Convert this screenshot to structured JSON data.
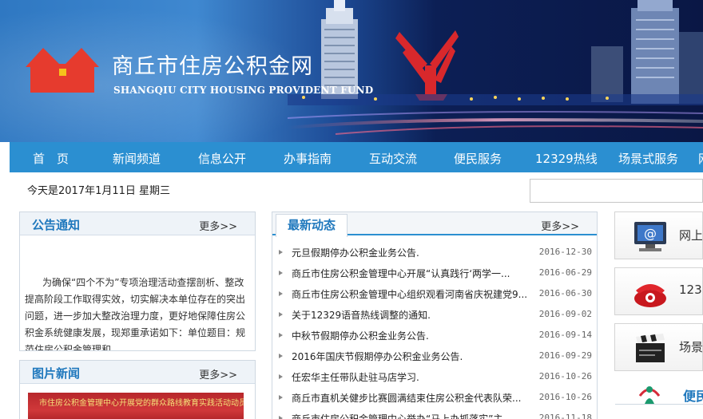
{
  "header": {
    "title": "商丘市住房公积金网",
    "subtitle": "SHANGQIU CITY HOUSING PROVIDENT FUND"
  },
  "nav": [
    {
      "label": "首　页"
    },
    {
      "label": "新闻频道"
    },
    {
      "label": "信息公开"
    },
    {
      "label": "办事指南"
    },
    {
      "label": "互动交流"
    },
    {
      "label": "便民服务"
    },
    {
      "label": "12329热线"
    },
    {
      "label": "场景式服务"
    },
    {
      "label": "网"
    }
  ],
  "date_line": "今天是2017年1月11日  星期三",
  "notice": {
    "title": "公告通知",
    "more": "更多>>",
    "body": "为确保“四个不为”专项治理活动查摆剖析、整改提高阶段工作取得实效，切实解决本单位存在的突出问题，进一步加大整改治理力度，更好地保障住房公积金系统健康发展，现郑重承诺如下：单位题目：规范住房公积金管理和"
  },
  "photo_news": {
    "title": "图片新闻",
    "more": "更多>>",
    "caption": "市住房公积金管理中心开展党的群众路线教育实践活动动员大会"
  },
  "latest": {
    "title": "最新动态",
    "more": "更多>>",
    "items": [
      {
        "title": "元旦假期停办公积金业务公告.",
        "date": "2016-12-30"
      },
      {
        "title": "商丘市住房公积金管理中心开展“认真践行‘两学一...",
        "date": "2016-06-29"
      },
      {
        "title": "商丘市住房公积金管理中心组织观看河南省庆祝建党9...",
        "date": "2016-06-30"
      },
      {
        "title": "关于12329语音热线调整的通知.",
        "date": "2016-09-02"
      },
      {
        "title": "中秋节假期停办公积金业务公告.",
        "date": "2016-09-14"
      },
      {
        "title": "2016年国庆节假期停办公积金业务公告.",
        "date": "2016-09-29"
      },
      {
        "title": "任宏华主任带队赴驻马店学习.",
        "date": "2016-10-26"
      },
      {
        "title": "商丘市直机关健步比赛圆满结束住房公积金代表队荣...",
        "date": "2016-10-26"
      },
      {
        "title": "商丘市住房公积金管理中心举办“马上办抓落实”主...",
        "date": "2016-11-18"
      }
    ]
  },
  "services": [
    {
      "label": "网上",
      "icon": "email-monitor-icon"
    },
    {
      "label": "123",
      "icon": "telephone-icon"
    },
    {
      "label": "场景",
      "icon": "clapperboard-icon"
    }
  ],
  "bianmin_label": "便民",
  "colors": {
    "nav_bg": "#2b8fd1",
    "title_blue": "#1f78bd",
    "logo_red": "#e63b2e"
  }
}
